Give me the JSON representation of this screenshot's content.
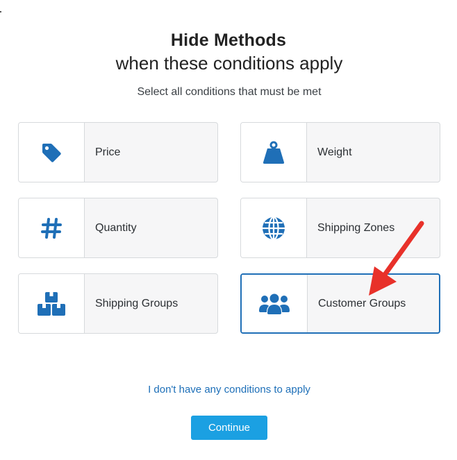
{
  "header": {
    "title": "Hide Methods",
    "subtitle": "when these conditions apply",
    "instructions": "Select all conditions that must be met"
  },
  "conditions": [
    {
      "label": "Price",
      "icon": "tag-icon",
      "selected": false
    },
    {
      "label": "Weight",
      "icon": "weight-icon",
      "selected": false
    },
    {
      "label": "Quantity",
      "icon": "hash-icon",
      "selected": false
    },
    {
      "label": "Shipping Zones",
      "icon": "globe-icon",
      "selected": false
    },
    {
      "label": "Shipping Groups",
      "icon": "boxes-icon",
      "selected": false
    },
    {
      "label": "Customer Groups",
      "icon": "users-icon",
      "selected": true
    }
  ],
  "footer": {
    "no_conditions_link": "I don't have any conditions to apply",
    "continue_label": "Continue"
  },
  "colors": {
    "icon_blue": "#1f6fb7",
    "accent_button": "#1ba0e2",
    "arrow_red": "#e8312a"
  }
}
